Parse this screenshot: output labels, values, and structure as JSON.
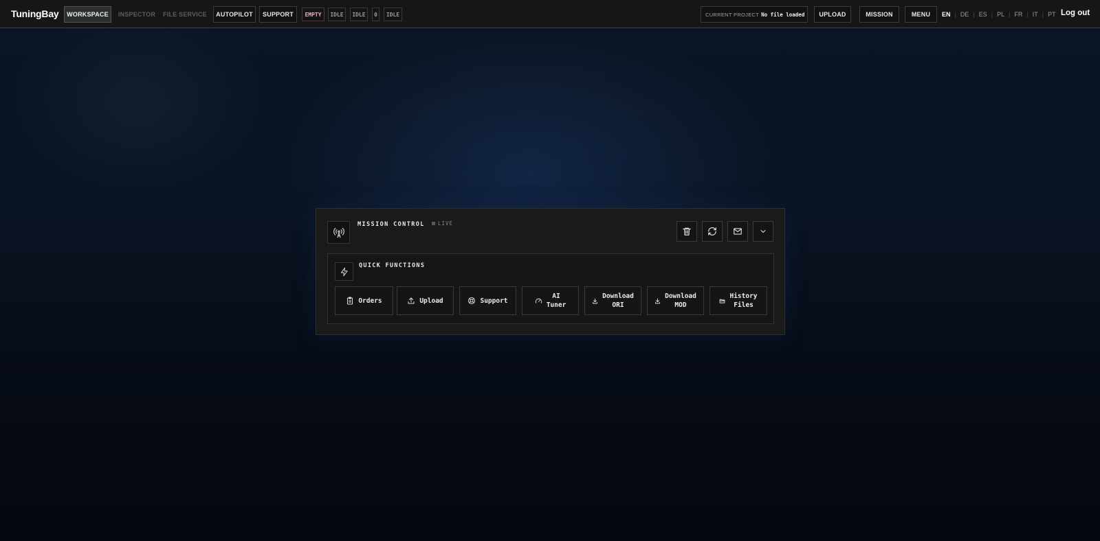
{
  "app": {
    "name": "TuningBay"
  },
  "nav": {
    "tabs": [
      {
        "label": "WORKSPACE",
        "state": "active"
      },
      {
        "label": "INSPECTOR",
        "state": "disabled"
      },
      {
        "label": "FILE SERVICE",
        "state": "disabled"
      },
      {
        "label": "AUTOPILOT",
        "state": "normal"
      },
      {
        "label": "SUPPORT",
        "state": "normal"
      }
    ],
    "status_chips": [
      "EMPTY",
      "IDLE",
      "IDLE",
      "0",
      "IDLE"
    ]
  },
  "project": {
    "label": "CURRENT PROJECT",
    "value": "No file loaded"
  },
  "actions": {
    "upload": "UPLOAD",
    "mission": "MISSION",
    "menu": "MENU"
  },
  "languages": {
    "items": [
      "EN",
      "DE",
      "ES",
      "PL",
      "FR",
      "IT",
      "PT"
    ],
    "current": "EN"
  },
  "logout": "Log out",
  "mission_control": {
    "title": "MISSION CONTROL",
    "status": "LIVE",
    "header_icons": [
      "trash-icon",
      "refresh-icon",
      "mail-icon",
      "chevron-down-icon"
    ]
  },
  "quick_functions": {
    "title": "QUICK FUNCTIONS",
    "buttons": [
      {
        "label": "Orders",
        "icon": "clipboard-icon"
      },
      {
        "label": "Upload",
        "icon": "upload-icon"
      },
      {
        "label": "Support",
        "icon": "lifebuoy-icon"
      },
      {
        "label": "AI\nTuner",
        "icon": "gauge-icon"
      },
      {
        "label": "Download\nORI",
        "icon": "download-icon"
      },
      {
        "label": "Download\nMOD",
        "icon": "download-icon"
      },
      {
        "label": "History\nFiles",
        "icon": "folder-icon"
      }
    ]
  },
  "colors": {
    "background": "#0a1322",
    "topbar": "#161616",
    "panel": "#1a1a1a",
    "accent_line": "#3a3f5a"
  }
}
